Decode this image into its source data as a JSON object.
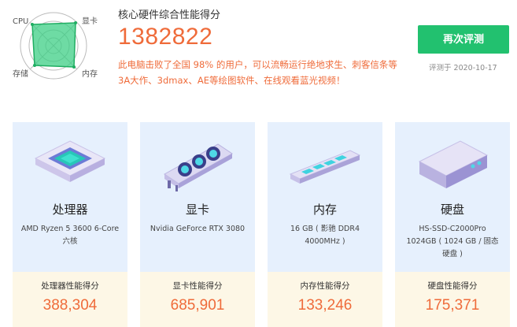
{
  "radar": {
    "labels": {
      "cpu": "CPU",
      "gpu": "显卡",
      "ram": "内存",
      "disk": "存储"
    },
    "colors": {
      "fill": "#3ecf85",
      "stroke": "#1fae62",
      "grid": "#bbbbbb"
    }
  },
  "header": {
    "title": "核心硬件综合性能得分",
    "score": "1382822",
    "description": "此电脑击败了全国 98% 的用户，可以流畅运行绝地求生、刺客信条等3A大作、3dmax、AE等绘图软件、在线观看蓝光视频！",
    "retest_label": "再次评测",
    "date": "评测于 2020-10-17"
  },
  "cards": [
    {
      "name": "处理器",
      "spec": "AMD Ryzen 5 3600 6-Core 六核",
      "score_label": "处理器性能得分",
      "score": "388,304",
      "icon": "cpu-chip-icon"
    },
    {
      "name": "显卡",
      "spec": "Nvidia GeForce RTX 3080",
      "score_label": "显卡性能得分",
      "score": "685,901",
      "icon": "graphics-card-icon"
    },
    {
      "name": "内存",
      "spec": "16 GB ( 影驰 DDR4 4000MHz )",
      "score_label": "内存性能得分",
      "score": "133,246",
      "icon": "memory-stick-icon"
    },
    {
      "name": "硬盘",
      "spec": "HS-SSD-C2000Pro 1024GB ( 1024 GB / 固态硬盘 )",
      "score_label": "硬盘性能得分",
      "score": "175,371",
      "icon": "hard-disk-icon"
    }
  ],
  "colors": {
    "accent": "#ef6b3a",
    "button": "#22c16f",
    "card_top": "#e6f0fd",
    "card_bottom": "#fdf7e6"
  }
}
